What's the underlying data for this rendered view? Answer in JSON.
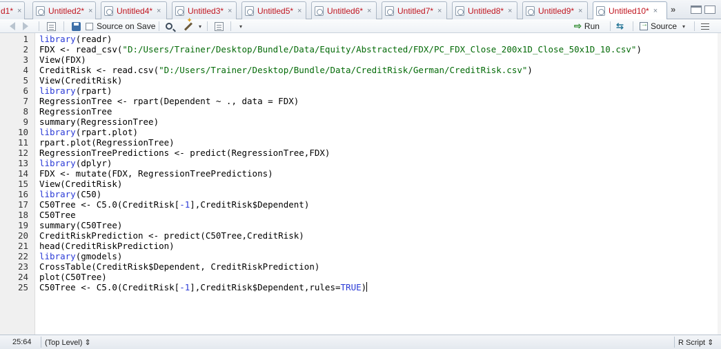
{
  "tabs": [
    {
      "label": "d1*",
      "close": "×"
    },
    {
      "label": "Untitled2*",
      "close": "×"
    },
    {
      "label": "Untitled4*",
      "close": "×"
    },
    {
      "label": "Untitled3*",
      "close": "×"
    },
    {
      "label": "Untitled5*",
      "close": "×"
    },
    {
      "label": "Untitled6*",
      "close": "×"
    },
    {
      "label": "Untitled7*",
      "close": "×"
    },
    {
      "label": "Untitled8*",
      "close": "×"
    },
    {
      "label": "Untitled9*",
      "close": "×"
    },
    {
      "label": "Untitled10*",
      "close": "×",
      "active": true
    }
  ],
  "tab_overflow": "»",
  "toolbar": {
    "source_on_save_label": "Source on Save",
    "run_label": "Run",
    "source_label": "Source",
    "caret": "▾"
  },
  "editor": {
    "lines": [
      {
        "no": "1",
        "tokens": [
          {
            "t": "library",
            "c": "kw"
          },
          {
            "t": "(readr)"
          }
        ]
      },
      {
        "no": "2",
        "tokens": [
          {
            "t": "FDX <- read_csv("
          },
          {
            "t": "\"D:/Users/Trainer/Desktop/Bundle/Data/Equity/Abstracted/FDX/PC_FDX_Close_200x1D_Close_50x1D_10.csv\"",
            "c": "str"
          },
          {
            "t": ")"
          }
        ]
      },
      {
        "no": "3",
        "tokens": [
          {
            "t": "View(FDX)"
          }
        ]
      },
      {
        "no": "4",
        "tokens": [
          {
            "t": "CreditRisk <- read.csv("
          },
          {
            "t": "\"D:/Users/Trainer/Desktop/Bundle/Data/CreditRisk/German/CreditRisk.csv\"",
            "c": "str"
          },
          {
            "t": ")"
          }
        ]
      },
      {
        "no": "5",
        "tokens": [
          {
            "t": "View(CreditRisk)"
          }
        ]
      },
      {
        "no": "6",
        "tokens": [
          {
            "t": "library",
            "c": "kw"
          },
          {
            "t": "(rpart)"
          }
        ]
      },
      {
        "no": "7",
        "tokens": [
          {
            "t": "RegressionTree <- rpart(Dependent ~ ., data = FDX)"
          }
        ]
      },
      {
        "no": "8",
        "tokens": [
          {
            "t": "RegressionTree"
          }
        ]
      },
      {
        "no": "9",
        "tokens": [
          {
            "t": "summary(RegressionTree)"
          }
        ]
      },
      {
        "no": "10",
        "tokens": [
          {
            "t": "library",
            "c": "kw"
          },
          {
            "t": "(rpart.plot)"
          }
        ]
      },
      {
        "no": "11",
        "tokens": [
          {
            "t": "rpart.plot(RegressionTree)"
          }
        ]
      },
      {
        "no": "12",
        "tokens": [
          {
            "t": "RegressionTreePredictions <- predict(RegressionTree,FDX)"
          }
        ]
      },
      {
        "no": "13",
        "tokens": [
          {
            "t": "library",
            "c": "kw"
          },
          {
            "t": "(dplyr)"
          }
        ]
      },
      {
        "no": "14",
        "tokens": [
          {
            "t": "FDX <- mutate(FDX, RegressionTreePredictions)"
          }
        ]
      },
      {
        "no": "15",
        "tokens": [
          {
            "t": "View(CreditRisk)"
          }
        ]
      },
      {
        "no": "16",
        "tokens": [
          {
            "t": "library",
            "c": "kw"
          },
          {
            "t": "(C50)"
          }
        ]
      },
      {
        "no": "17",
        "tokens": [
          {
            "t": "C50Tree <- C5.0(CreditRisk["
          },
          {
            "t": "-1",
            "c": "num"
          },
          {
            "t": "],CreditRisk$Dependent)"
          }
        ]
      },
      {
        "no": "18",
        "tokens": [
          {
            "t": "C50Tree"
          }
        ]
      },
      {
        "no": "19",
        "tokens": [
          {
            "t": "summary(C50Tree)"
          }
        ]
      },
      {
        "no": "20",
        "tokens": [
          {
            "t": "CreditRiskPrediction <- predict(C50Tree,CreditRisk)"
          }
        ]
      },
      {
        "no": "21",
        "tokens": [
          {
            "t": "head(CreditRiskPrediction)"
          }
        ]
      },
      {
        "no": "22",
        "tokens": [
          {
            "t": "library",
            "c": "kw"
          },
          {
            "t": "(gmodels)"
          }
        ]
      },
      {
        "no": "23",
        "tokens": [
          {
            "t": "CrossTable(CreditRisk$Dependent, CreditRiskPrediction)"
          }
        ]
      },
      {
        "no": "24",
        "tokens": [
          {
            "t": "plot(C50Tree)"
          }
        ]
      },
      {
        "no": "25",
        "tokens": [
          {
            "t": "C50Tree <- C5.0(CreditRisk["
          },
          {
            "t": "-1",
            "c": "num"
          },
          {
            "t": "],CreditRisk$Dependent,rules="
          },
          {
            "t": "TRUE",
            "c": "num"
          },
          {
            "t": ")"
          }
        ],
        "cursor": true
      }
    ]
  },
  "status": {
    "position": "25:64",
    "scope": "(Top Level) ⇕",
    "filetype": "R Script ⇕"
  },
  "colors": {
    "keyword": "#2a3ad6",
    "string": "#036a07",
    "tab_label": "#c0141e"
  }
}
